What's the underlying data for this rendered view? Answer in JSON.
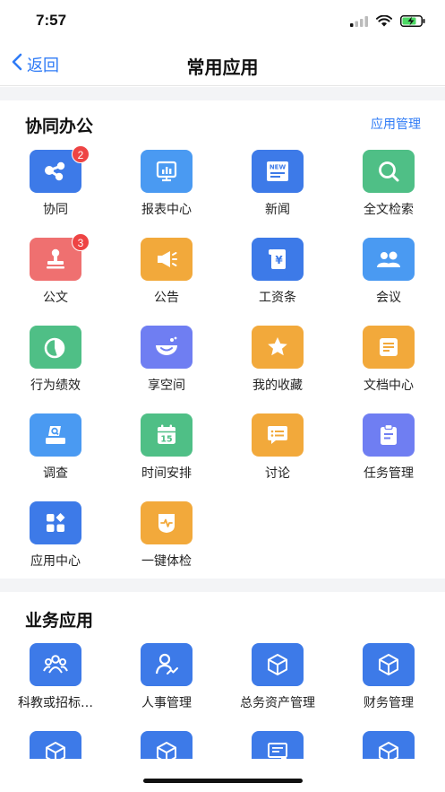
{
  "status": {
    "time": "7:57"
  },
  "nav": {
    "back_label": "返回",
    "title": "常用应用"
  },
  "section1": {
    "title": "协同办公",
    "action": "应用管理",
    "items": [
      {
        "label": "协同",
        "icon": "share-nodes-icon",
        "color": "#3d7ae8",
        "badge": "2"
      },
      {
        "label": "报表中心",
        "icon": "bar-chart-icon",
        "color": "#4a9af2",
        "badge": ""
      },
      {
        "label": "新闻",
        "icon": "newspaper-icon",
        "color": "#3d7ae8",
        "badge": ""
      },
      {
        "label": "全文检索",
        "icon": "search-icon",
        "color": "#4fbf86",
        "badge": ""
      },
      {
        "label": "公文",
        "icon": "stamp-icon",
        "color": "#ef7070",
        "badge": "3"
      },
      {
        "label": "公告",
        "icon": "megaphone-icon",
        "color": "#f2a93b",
        "badge": ""
      },
      {
        "label": "工资条",
        "icon": "salary-scroll-icon",
        "color": "#3d7ae8",
        "badge": ""
      },
      {
        "label": "会议",
        "icon": "people-icon",
        "color": "#4a9af2",
        "badge": ""
      },
      {
        "label": "行为绩效",
        "icon": "pie-chart-icon",
        "color": "#4fbf86",
        "badge": ""
      },
      {
        "label": "享空间",
        "icon": "bowl-smile-icon",
        "color": "#6f7ef2",
        "badge": ""
      },
      {
        "label": "我的收藏",
        "icon": "star-icon",
        "color": "#f2a93b",
        "badge": ""
      },
      {
        "label": "文档中心",
        "icon": "document-icon",
        "color": "#f2a93b",
        "badge": ""
      },
      {
        "label": "调查",
        "icon": "survey-icon",
        "color": "#4a9af2",
        "badge": ""
      },
      {
        "label": "时间安排",
        "icon": "calendar-icon",
        "color": "#4fbf86",
        "badge": ""
      },
      {
        "label": "讨论",
        "icon": "chat-bubble-icon",
        "color": "#f2a93b",
        "badge": ""
      },
      {
        "label": "任务管理",
        "icon": "clipboard-icon",
        "color": "#6f7ef2",
        "badge": ""
      },
      {
        "label": "应用中心",
        "icon": "app-grid-icon",
        "color": "#3d7ae8",
        "badge": ""
      },
      {
        "label": "一键体检",
        "icon": "health-check-icon",
        "color": "#f2a93b",
        "badge": ""
      }
    ]
  },
  "section2": {
    "title": "业务应用",
    "items": [
      {
        "label": "科教或招标…",
        "icon": "group-icon",
        "color": "#3d7ae8"
      },
      {
        "label": "人事管理",
        "icon": "person-chart-icon",
        "color": "#3d7ae8"
      },
      {
        "label": "总务资产管理",
        "icon": "cube-icon",
        "color": "#3d7ae8"
      },
      {
        "label": "财务管理",
        "icon": "cube-icon",
        "color": "#3d7ae8"
      },
      {
        "label": "",
        "icon": "cube-icon",
        "color": "#3d7ae8"
      },
      {
        "label": "",
        "icon": "cube-icon",
        "color": "#3d7ae8"
      },
      {
        "label": "",
        "icon": "report-icon",
        "color": "#3d7ae8"
      },
      {
        "label": "",
        "icon": "cube-icon",
        "color": "#3d7ae8"
      }
    ]
  }
}
